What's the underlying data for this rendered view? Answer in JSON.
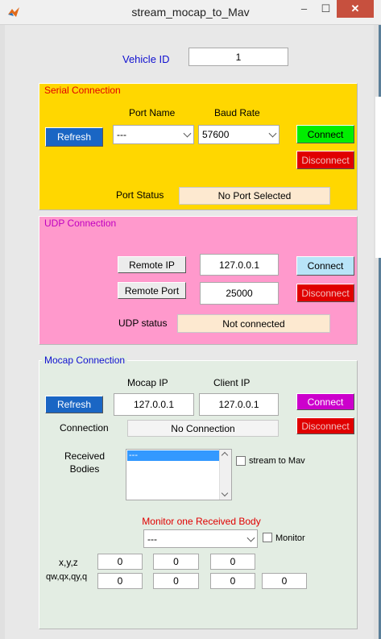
{
  "window": {
    "title": "stream_mocap_to_Mav",
    "minimize": "–",
    "maximize": "☐",
    "close": "✕"
  },
  "vehicle": {
    "label": "Vehicle ID",
    "value": "1"
  },
  "serial": {
    "title": "Serial Connection",
    "port_name_label": "Port Name",
    "baud_rate_label": "Baud Rate",
    "refresh": "Refresh",
    "port_value": "---",
    "baud_value": "57600",
    "connect": "Connect",
    "disconnect": "Disconnect",
    "status_label": "Port Status",
    "status_value": "No Port Selected"
  },
  "udp": {
    "title": "UDP Connection",
    "remote_ip_label": "Remote IP",
    "remote_ip_value": "127.0.0.1",
    "remote_port_label": "Remote Port",
    "remote_port_value": "25000",
    "connect": "Connect",
    "disconnect": "Disconnect",
    "status_label": "UDP status",
    "status_value": "Not connected"
  },
  "mocap": {
    "title": "Mocap Connection",
    "mocap_ip_label": "Mocap IP",
    "client_ip_label": "Client IP",
    "refresh": "Refresh",
    "mocap_ip_value": "127.0.0.1",
    "client_ip_value": "127.0.0.1",
    "connect": "Connect",
    "disconnect": "Disconnect",
    "connection_label": "Connection",
    "connection_value": "No Connection",
    "received_bodies_label": "Received\nBodies",
    "bodies": [
      "---"
    ],
    "stream_label": "stream to Mav",
    "monitor_title": "Monitor one Received Body",
    "monitor_select": "---",
    "monitor_label": "Monitor",
    "xyz_label": "x,y,z",
    "quat_label": "qw,qx,qy,q",
    "xyz_values": [
      "0",
      "0",
      "0"
    ],
    "quat_values": [
      "0",
      "0",
      "0",
      "0"
    ]
  },
  "colors": {
    "serial_panel": "#ffd700",
    "udp_panel": "#ff99cc",
    "mocap_panel": "#e3ede3",
    "refresh_button": "#1a66c4",
    "connect_green": "#00ee00",
    "connect_cyan": "#b8e4f8",
    "connect_magenta": "#cc00cc",
    "disconnect_red": "#e00000",
    "status_field": "#fde9d0"
  }
}
